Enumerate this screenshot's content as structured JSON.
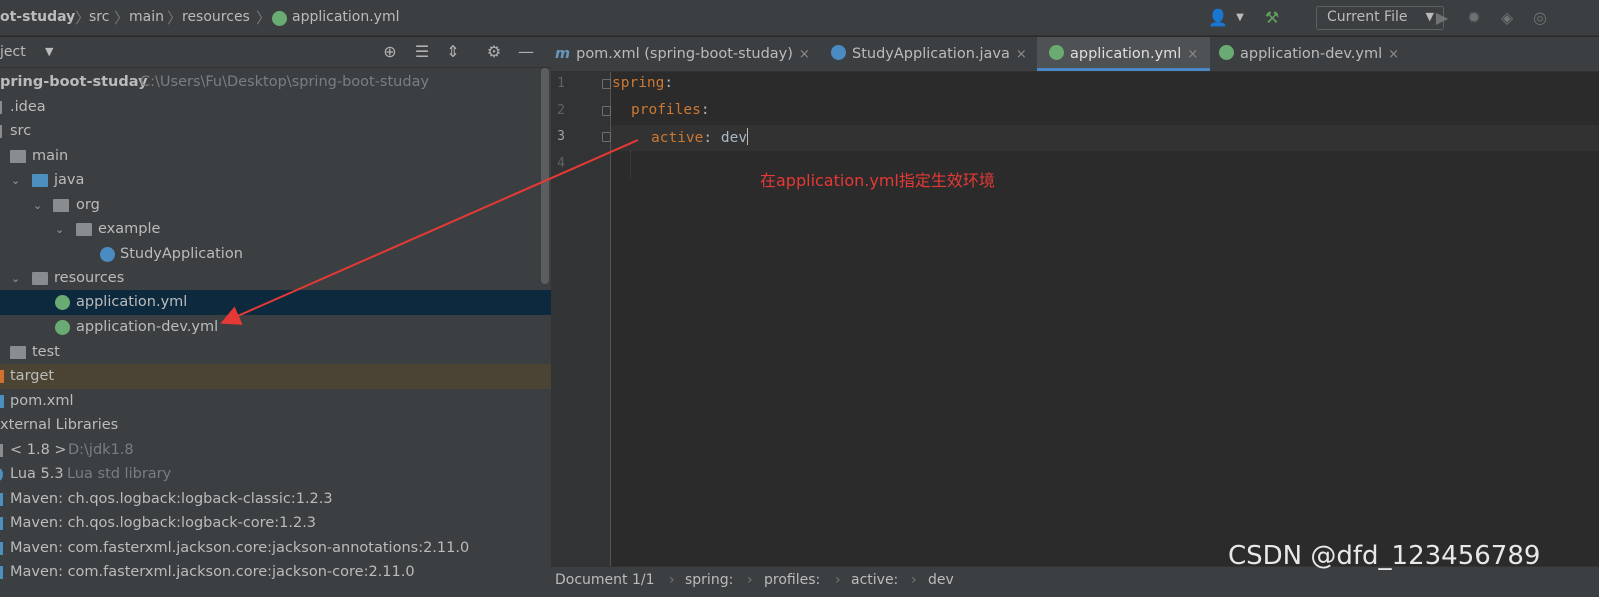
{
  "breadcrumbs": [
    "ot-studay",
    "src",
    "main",
    "resources",
    "application.yml"
  ],
  "toolbar": {
    "run_config": "Current File"
  },
  "project_panel": {
    "title": "ject",
    "tree": [
      {
        "label": "pring-boot-studay",
        "hint": "C:\\Users\\Fu\\Desktop\\spring-boot-studay"
      },
      {
        "label": ".idea"
      },
      {
        "label": "src"
      },
      {
        "label": "main"
      },
      {
        "label": "java"
      },
      {
        "label": "org"
      },
      {
        "label": "example"
      },
      {
        "label": "StudyApplication"
      },
      {
        "label": "resources"
      },
      {
        "label": "application.yml"
      },
      {
        "label": "application-dev.yml"
      },
      {
        "label": "test"
      },
      {
        "label": "target"
      },
      {
        "label": "pom.xml"
      },
      {
        "label": "xternal Libraries"
      },
      {
        "label": "< 1.8 >",
        "hint": "D:\\jdk1.8"
      },
      {
        "label": "Lua 5.3",
        "hint": "Lua std library"
      },
      {
        "label": "Maven: ch.qos.logback:logback-classic:1.2.3"
      },
      {
        "label": "Maven: ch.qos.logback:logback-core:1.2.3"
      },
      {
        "label": "Maven: com.fasterxml.jackson.core:jackson-annotations:2.11.0"
      },
      {
        "label": "Maven: com.fasterxml.jackson.core:jackson-core:2.11.0"
      }
    ]
  },
  "tabs": [
    {
      "label": "pom.xml (spring-boot-studay)",
      "icon_text": "m"
    },
    {
      "label": "StudyApplication.java"
    },
    {
      "label": "application.yml"
    },
    {
      "label": "application-dev.yml"
    }
  ],
  "tab_close": "×",
  "editor": {
    "line_numbers": [
      "1",
      "2",
      "3",
      "4"
    ],
    "lines": [
      {
        "key": "spring",
        "punct": ":"
      },
      {
        "key": "profiles",
        "punct": ":"
      },
      {
        "key": "active",
        "punct": ": ",
        "value": "dev"
      }
    ],
    "annotation": "在application.yml指定生效环境"
  },
  "statusbar": {
    "document": "Document 1/1",
    "path": [
      "spring:",
      "profiles:",
      "active:",
      "dev"
    ]
  },
  "watermark": "CSDN @dfd_123456789",
  "colors": {
    "accent": "#4a88c7",
    "annotation": "#e53935",
    "yaml_key": "#cc7832",
    "selection": "#0d293e"
  }
}
